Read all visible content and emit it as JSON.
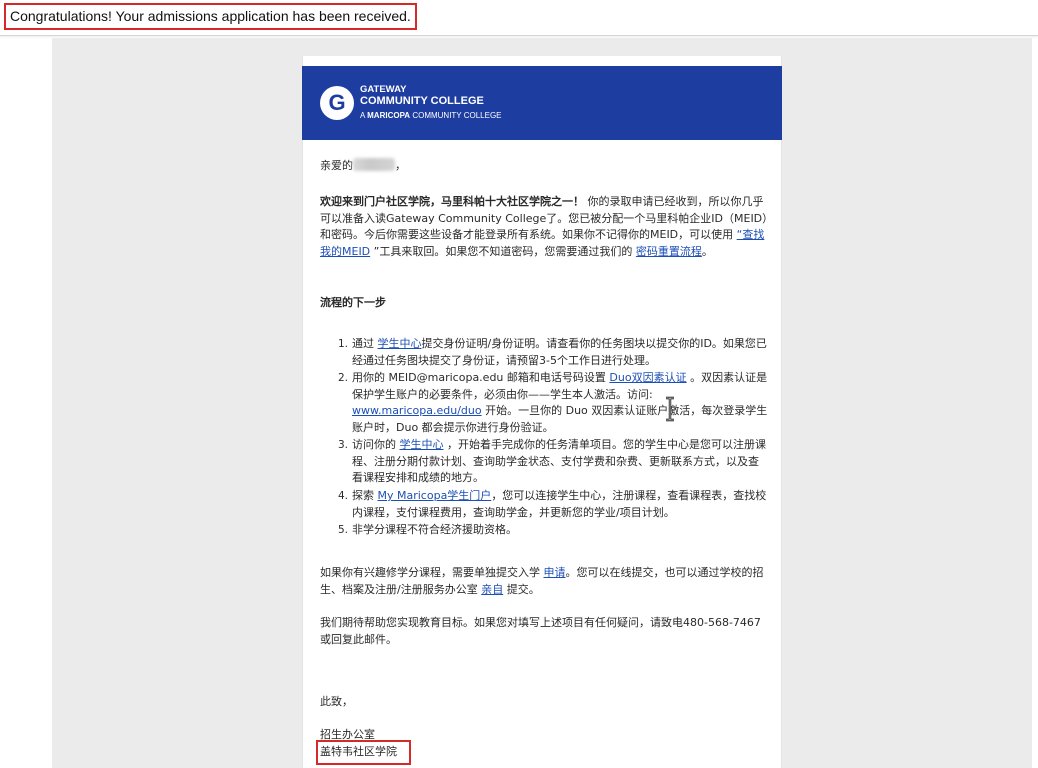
{
  "subject": "Congratulations! Your admissions application has been received.",
  "header": {
    "brand_line1": "GATEWAY",
    "brand_line2": "COMMUNITY COLLEGE",
    "brand_line3_a": "A ",
    "brand_line3_b": "MARICOPA",
    "brand_line3_c": " COMMUNITY COLLEGE",
    "bg_color": "#1e3da1"
  },
  "greeting_prefix": "亲爱的",
  "greeting_suffix": "，",
  "intro": {
    "bold": "欢迎来到门户社区学院，马里科帕十大社区学院之一！",
    "text1": " 你的录取申请已经收到，所以你几乎可以准备入读Gateway Community College了。您已被分配一个马里科帕企业ID（MEID）和密码。今后你需要这些设备才能登录所有系统。如果你不记得你的MEID，可以使用 ",
    "link1": "“查找我的MEID",
    "text2": " ”工具来取回。如果您不知道密码，您需要通过我们的 ",
    "link2": "密码重置流程",
    "text3": "。"
  },
  "next_steps_title": "流程的下一步",
  "steps": [
    {
      "num": "1.",
      "a": "通过 ",
      "link": "学生中心",
      "b": "提交身份证明/身份证明。请查看你的任务图块以提交你的ID。如果您已经通过任务图块提交了身份证，请预留3-5个工作日进行处理。"
    },
    {
      "num": "2.",
      "a": "用你的 MEID@maricopa.edu 邮箱和电话号码设置 ",
      "link": "Duo双因素认证",
      "b": " 。双因素认证是保护学生账户的必要条件，必须由你——学生本人激活。访问: ",
      "link2": "www.maricopa.edu/duo",
      "c": " 开始。一旦你的 Duo 双因素认证账户激活，每次登录学生账户时，Duo 都会提示你进行身份验证。"
    },
    {
      "num": "3.",
      "a": "访问你的 ",
      "link": "学生中心",
      "b": " ，开始着手完成你的任务清单项目。您的学生中心是您可以注册课程、注册分期付款计划、查询助学金状态、支付学费和杂费、更新联系方式，以及查看课程安排和成绩的地方。"
    },
    {
      "num": "4.",
      "a": "探索 ",
      "link": "My Maricopa学生门户",
      "b": "，您可以连接学生中心，注册课程，查看课程表，查找校内课程，支付课程费用，查询助学金，并更新您的学业/项目计划。"
    },
    {
      "num": "5.",
      "a": "非学分课程不符合经济援助资格。"
    }
  ],
  "para_noncredit": {
    "a": "如果你有兴趣修学分课程，需要单独提交入学 ",
    "link1": "申请",
    "b": "。您可以在线提交，也可以通过学校的招生、档案及注册/注册服务办公室 ",
    "link2": "亲自",
    "c": " 提交。"
  },
  "para_contact": "我们期待帮助您实现教育目标。如果您对填写上述项目有任何疑问，请致电480-568-7467或回复此邮件。",
  "closing": "此致，",
  "signature_office": "招生办公室",
  "signature_college": "盖特韦社区学院",
  "colors": {
    "link": "#1c4fb5",
    "highlight_box": "#d42a2a"
  }
}
